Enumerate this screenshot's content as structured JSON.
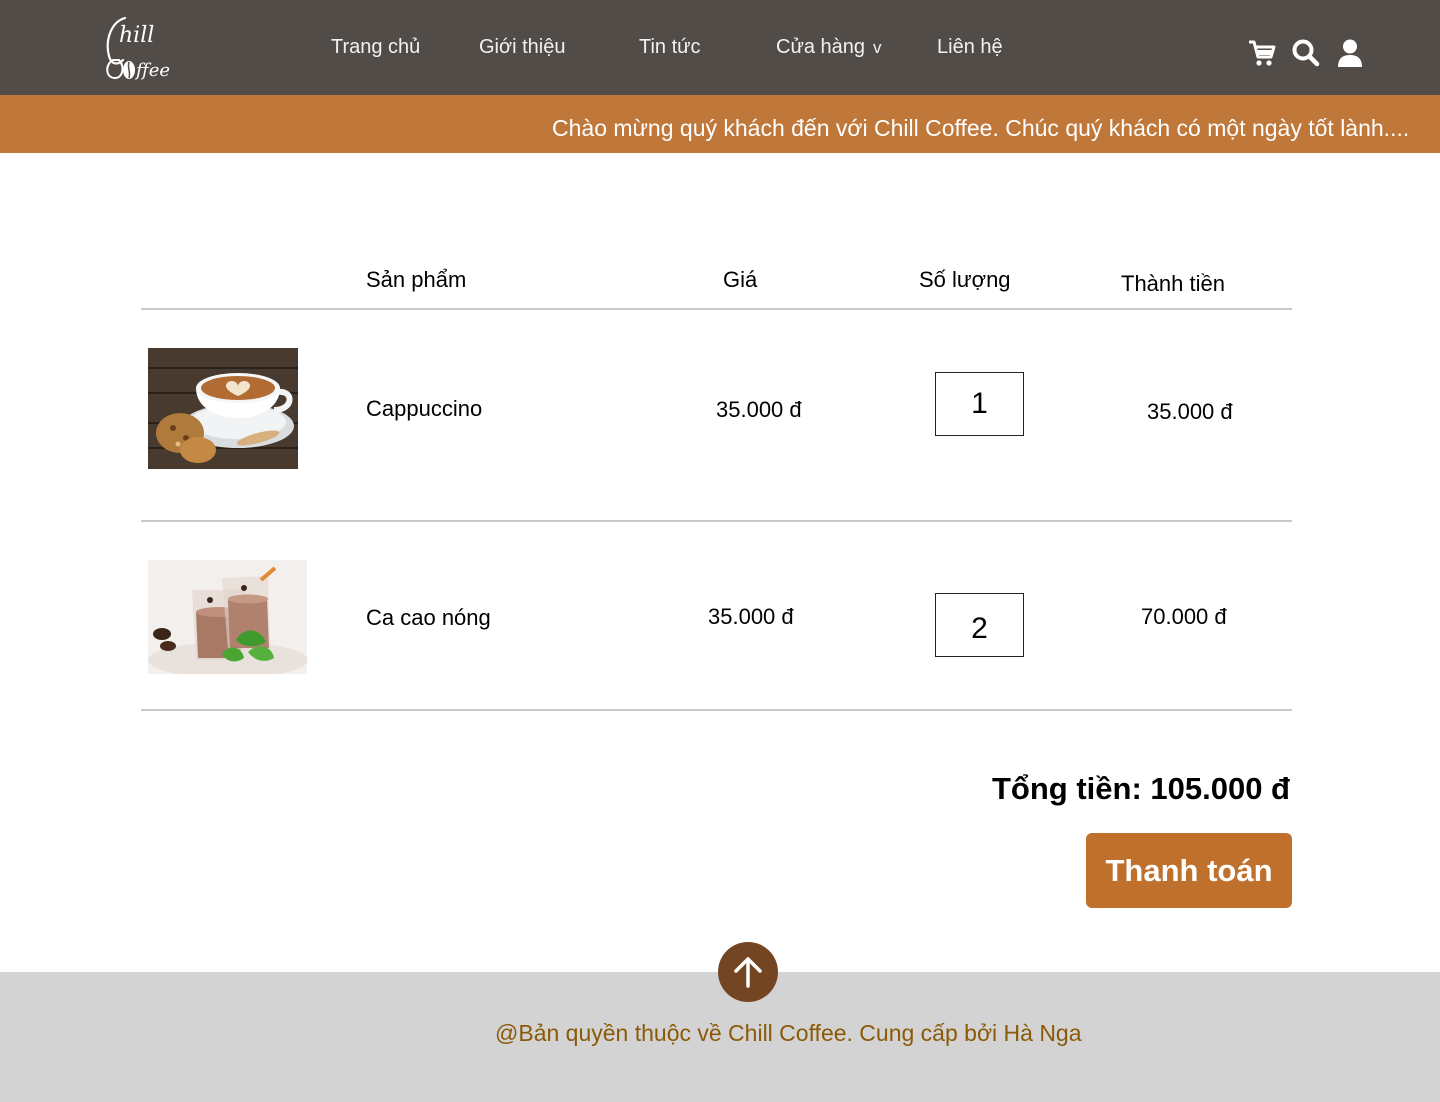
{
  "brand": {
    "logo_top": "hill",
    "logo_bottom": "ffee"
  },
  "nav": {
    "home": "Trang chủ",
    "about": "Giới thiệu",
    "news": "Tin tức",
    "shop": "Cửa hàng",
    "shop_chevron": "v",
    "contact": "Liên hệ"
  },
  "header_icons": [
    "cart-icon",
    "search-icon",
    "user-icon"
  ],
  "marquee": "Chào mừng quý khách đến với Chill Coffee. Chúc quý khách có một ngày tốt lành....",
  "cart": {
    "headers": {
      "product": "Sản phẩm",
      "price": "Giá",
      "quantity": "Số lượng",
      "subtotal": "Thành tiền"
    },
    "items": [
      {
        "name": "Cappuccino",
        "price": "35.000 đ",
        "quantity": "1",
        "subtotal": "35.000 đ"
      },
      {
        "name": "Ca cao nóng",
        "price": "35.000 đ",
        "quantity": "2",
        "subtotal": "70.000 đ"
      }
    ],
    "total": "Tổng tiền: 105.000 đ",
    "checkout": "Thanh toán"
  },
  "footer": {
    "copyright": "@Bản quyền thuộc về Chill Coffee. Cung cấp bởi Hà Nga"
  },
  "colors": {
    "header_bg": "#524c48",
    "accent": "#c0773a",
    "checkout_bg": "#c0702d",
    "footer_bg": "#d3d3d3",
    "footer_text": "#8a5a08",
    "to_top_bg": "#744523"
  }
}
